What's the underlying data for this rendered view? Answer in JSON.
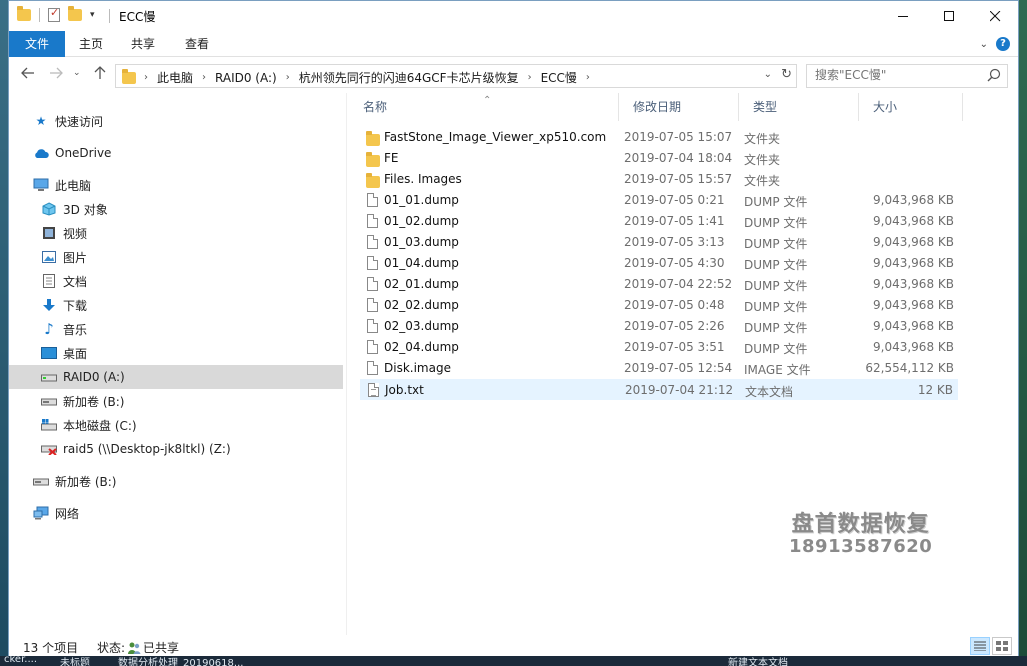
{
  "window": {
    "title": "ECC慢"
  },
  "ribbon": {
    "tabs": [
      "文件",
      "主页",
      "共享",
      "查看"
    ]
  },
  "address": {
    "crumbs": [
      "此电脑",
      "RAID0 (A:)",
      "杭州领先同行的闪迪64GCF卡芯片级恢复",
      "ECC慢"
    ]
  },
  "search": {
    "placeholder": "搜索\"ECC慢\""
  },
  "nav": {
    "items": [
      {
        "label": "快速访问",
        "icon": "star-icon"
      },
      {
        "label": "OneDrive",
        "icon": "cloud-icon"
      },
      {
        "label": "此电脑",
        "icon": "computer-icon"
      },
      {
        "label": "3D 对象",
        "icon": "cube-icon"
      },
      {
        "label": "视频",
        "icon": "video-icon"
      },
      {
        "label": "图片",
        "icon": "picture-icon"
      },
      {
        "label": "文档",
        "icon": "document-icon"
      },
      {
        "label": "下载",
        "icon": "download-icon"
      },
      {
        "label": "音乐",
        "icon": "music-icon"
      },
      {
        "label": "桌面",
        "icon": "desktop-icon"
      },
      {
        "label": "RAID0 (A:)",
        "icon": "drive-icon"
      },
      {
        "label": "新加卷 (B:)",
        "icon": "drive-icon"
      },
      {
        "label": "本地磁盘 (C:)",
        "icon": "system-drive-icon"
      },
      {
        "label": "raid5 (\\\\Desktop-jk8ltkl) (Z:)",
        "icon": "network-drive-icon"
      },
      {
        "label": "新加卷 (B:)",
        "icon": "drive-icon"
      },
      {
        "label": "网络",
        "icon": "network-icon"
      }
    ]
  },
  "columns": {
    "name": "名称",
    "date": "修改日期",
    "type": "类型",
    "size": "大小"
  },
  "files": [
    {
      "name": "FastStone_Image_Viewer_xp510.com",
      "date": "2019-07-05 15:07",
      "type": "文件夹",
      "size": "",
      "kind": "folder"
    },
    {
      "name": "FE",
      "date": "2019-07-04 18:04",
      "type": "文件夹",
      "size": "",
      "kind": "folder"
    },
    {
      "name": "Files. Images",
      "date": "2019-07-05 15:57",
      "type": "文件夹",
      "size": "",
      "kind": "folder"
    },
    {
      "name": "01_01.dump",
      "date": "2019-07-05 0:21",
      "type": "DUMP 文件",
      "size": "9,043,968 KB",
      "kind": "file"
    },
    {
      "name": "01_02.dump",
      "date": "2019-07-05 1:41",
      "type": "DUMP 文件",
      "size": "9,043,968 KB",
      "kind": "file"
    },
    {
      "name": "01_03.dump",
      "date": "2019-07-05 3:13",
      "type": "DUMP 文件",
      "size": "9,043,968 KB",
      "kind": "file"
    },
    {
      "name": "01_04.dump",
      "date": "2019-07-05 4:30",
      "type": "DUMP 文件",
      "size": "9,043,968 KB",
      "kind": "file"
    },
    {
      "name": "02_01.dump",
      "date": "2019-07-04 22:52",
      "type": "DUMP 文件",
      "size": "9,043,968 KB",
      "kind": "file"
    },
    {
      "name": "02_02.dump",
      "date": "2019-07-05 0:48",
      "type": "DUMP 文件",
      "size": "9,043,968 KB",
      "kind": "file"
    },
    {
      "name": "02_03.dump",
      "date": "2019-07-05 2:26",
      "type": "DUMP 文件",
      "size": "9,043,968 KB",
      "kind": "file"
    },
    {
      "name": "02_04.dump",
      "date": "2019-07-05 3:51",
      "type": "DUMP 文件",
      "size": "9,043,968 KB",
      "kind": "file"
    },
    {
      "name": "Disk.image",
      "date": "2019-07-05 12:54",
      "type": "IMAGE 文件",
      "size": "62,554,112 KB",
      "kind": "file"
    },
    {
      "name": "Job.txt",
      "date": "2019-07-04 21:12",
      "type": "文本文档",
      "size": "12 KB",
      "kind": "txt"
    }
  ],
  "watermark": {
    "line1": "盘首数据恢复",
    "line2": "18913587620"
  },
  "status": {
    "count": "13 个项目",
    "state_label": "状态:",
    "state_value": "已共享"
  },
  "taskbar": {
    "items": [
      "cker....",
      "未标题",
      "数据分析处理_20190618...",
      "新建文本文档"
    ]
  },
  "colors": {
    "accent": "#1979ca",
    "selected_row": "#e5f3ff",
    "nav_selected": "#d9d9d9"
  }
}
